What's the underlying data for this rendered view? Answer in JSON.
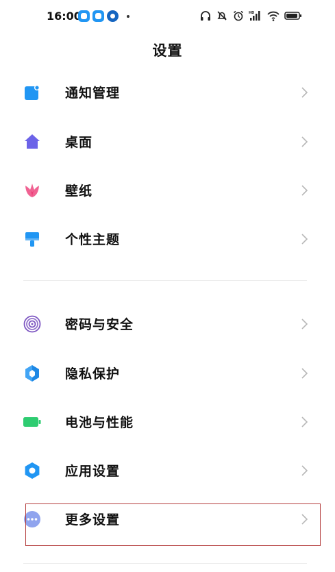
{
  "status_bar": {
    "time": "16:00"
  },
  "header": {
    "title": "设置"
  },
  "settings": {
    "group1": [
      {
        "label": "通知管理",
        "icon": "notification-icon"
      },
      {
        "label": "桌面",
        "icon": "home-icon"
      },
      {
        "label": "壁纸",
        "icon": "wallpaper-tulip-icon"
      },
      {
        "label": "个性主题",
        "icon": "theme-brush-icon"
      }
    ],
    "group2": [
      {
        "label": "密码与安全",
        "icon": "fingerprint-icon"
      },
      {
        "label": "隐私保护",
        "icon": "privacy-shield-icon"
      },
      {
        "label": "电池与性能",
        "icon": "battery-icon"
      },
      {
        "label": "应用设置",
        "icon": "app-gear-icon"
      },
      {
        "label": "更多设置",
        "icon": "more-dots-icon"
      }
    ]
  },
  "colors": {
    "notification": "#2196f3",
    "home": "#6c63e8",
    "wallpaper": "#f06292",
    "theme": "#2196f3",
    "fingerprint": "#7e57c2",
    "privacy": "#1e88e5",
    "battery": "#2ecc71",
    "app_settings": "#2196f3",
    "more": "#90a4ee",
    "highlight_border": "#b33a3a"
  }
}
